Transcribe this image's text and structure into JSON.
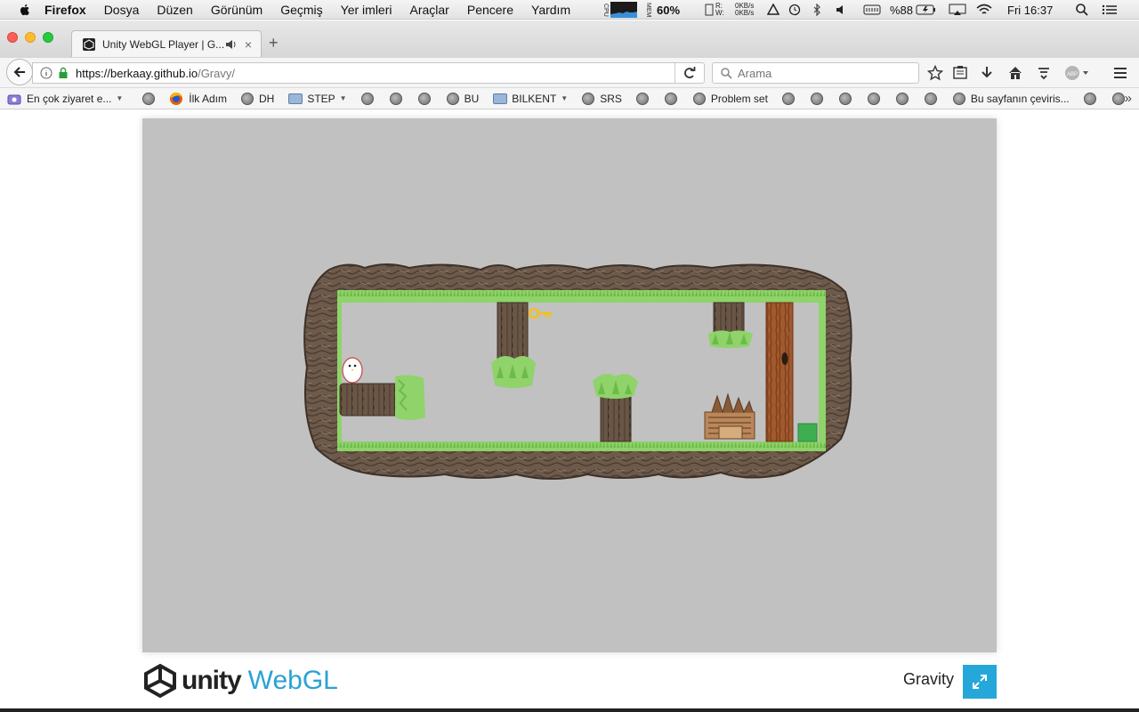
{
  "menubar": {
    "app": "Firefox",
    "items": [
      "Dosya",
      "Düzen",
      "Görünüm",
      "Geçmiş",
      "Yer imleri",
      "Araçlar",
      "Pencere",
      "Yardım"
    ],
    "cpu_label": "CPU",
    "mem_label": "MEM",
    "mem_percent": "60%",
    "disk_labels": "R:\nW:",
    "net_up": "0KB/s",
    "net_down": "0KB/s",
    "battery": "%88",
    "clock": "Fri 16:37"
  },
  "tab": {
    "title": "Unity WebGL Player | G...",
    "close": "×"
  },
  "new_tab": "+",
  "urlbar": {
    "url_host": "https://berkaay.github.io",
    "url_path": "/Gravy/"
  },
  "search": {
    "placeholder": "Arama"
  },
  "bookmarks": [
    {
      "label": "En çok ziyaret e...",
      "kind": "special",
      "caret": true
    },
    {
      "label": "",
      "kind": "globe"
    },
    {
      "label": "İlk Adım",
      "kind": "firefox"
    },
    {
      "label": "DH",
      "kind": "globe"
    },
    {
      "label": "STEP",
      "kind": "folder",
      "caret": true
    },
    {
      "label": "",
      "kind": "globe"
    },
    {
      "label": "",
      "kind": "globe"
    },
    {
      "label": "",
      "kind": "globe"
    },
    {
      "label": "BU",
      "kind": "globe"
    },
    {
      "label": "BILKENT",
      "kind": "folder",
      "caret": true
    },
    {
      "label": "SRS",
      "kind": "globe"
    },
    {
      "label": "",
      "kind": "globe"
    },
    {
      "label": "",
      "kind": "globe"
    },
    {
      "label": "Problem set",
      "kind": "globe"
    },
    {
      "label": "",
      "kind": "globe"
    },
    {
      "label": "",
      "kind": "globe"
    },
    {
      "label": "",
      "kind": "globe"
    },
    {
      "label": "",
      "kind": "globe"
    },
    {
      "label": "",
      "kind": "globe"
    },
    {
      "label": "",
      "kind": "globe"
    },
    {
      "label": "Bu sayfanın çeviris...",
      "kind": "globe"
    },
    {
      "label": "",
      "kind": "globe"
    },
    {
      "label": "",
      "kind": "globe"
    }
  ],
  "bookmarks_overflow": "»",
  "footer": {
    "unity_word": "unity",
    "webgl_word": "WebGL",
    "game_title": "Gravity"
  },
  "colors": {
    "canvas_bg": "#c1c1c1",
    "grass": "#8fd36a",
    "rock": "#6d5a4b",
    "accent_blue": "#26a7d9",
    "goal": "#3fae53",
    "key": "#f2c21b"
  }
}
